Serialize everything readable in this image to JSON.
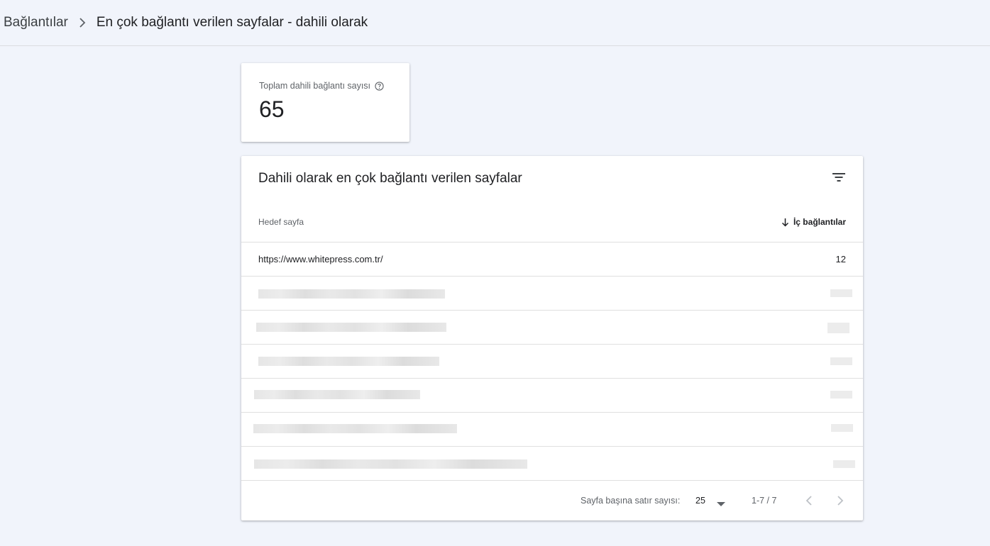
{
  "breadcrumb": {
    "root": "Bağlantılar",
    "current": "En çok bağlantı verilen sayfalar - dahili olarak"
  },
  "stat": {
    "label": "Toplam dahili bağlantı sayısı",
    "value": "65"
  },
  "table": {
    "title": "Dahili olarak en çok bağlantı verilen sayfalar",
    "columns": {
      "target": "Hedef sayfa",
      "inlinks": "İç bağlantılar"
    },
    "rows": [
      {
        "url": "https://www.whitepress.com.tr/",
        "count": "12"
      }
    ]
  },
  "pagination": {
    "rows_per_page_label": "Sayfa başına satır sayısı:",
    "rows_per_page_value": "25",
    "range": "1-7 / 7"
  },
  "icons": {
    "breadcrumb_separator": "chevron-right-icon",
    "help": "help-circle-icon",
    "filter": "filter-list-icon",
    "sort": "arrow-down-icon",
    "dropdown": "caret-down-icon",
    "prev": "chevron-left-icon",
    "next": "chevron-right-icon"
  }
}
